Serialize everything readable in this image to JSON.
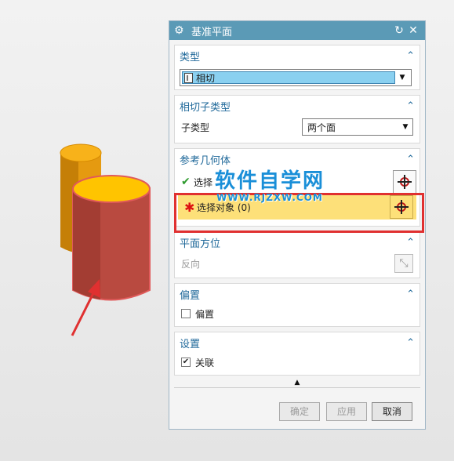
{
  "dialog": {
    "title": "基准平面",
    "sections": {
      "type": {
        "header": "类型",
        "selected": "相切"
      },
      "subtype": {
        "header": "相切子类型",
        "label": "子类型",
        "selected": "两个面"
      },
      "refgeo": {
        "header": "参考几何体",
        "first_label": "选择",
        "second_label": "选择对象 (0)"
      },
      "orient": {
        "header": "平面方位",
        "reverse_label": "反向"
      },
      "offset": {
        "header": "偏置",
        "checkbox_label": "偏置",
        "checked": false
      },
      "settings": {
        "header": "设置",
        "checkbox_label": "关联",
        "checked": true
      }
    },
    "buttons": {
      "ok": "确定",
      "apply": "应用",
      "cancel": "取消"
    }
  },
  "watermark": {
    "line1": "软件自学网",
    "line2": "WWW.RJZXW.COM"
  },
  "colors": {
    "accent": "#5b9ab6",
    "highlight": "#fde079",
    "red_box": "#e03030",
    "cylinder_red": "#b94a40",
    "cylinder_orange": "#e59a10"
  }
}
